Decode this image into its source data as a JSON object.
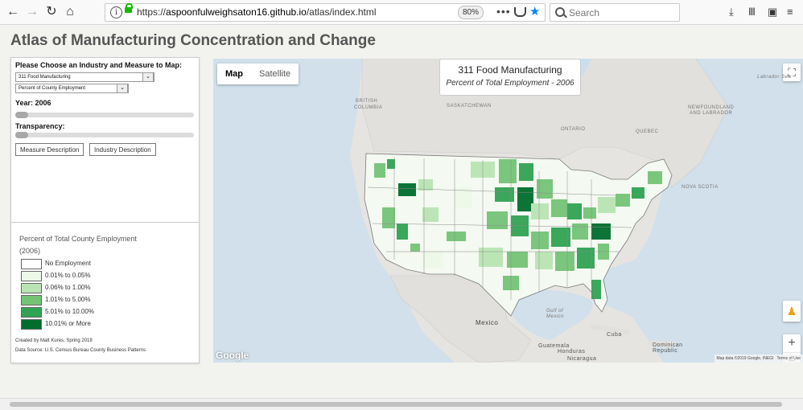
{
  "browser": {
    "url_prefix": "https://",
    "url_host": "aspoonfulweighsaton16.github.io",
    "url_path": "/atlas/index.html",
    "zoom": "80%",
    "search_placeholder": "Search",
    "more_dots": "•••"
  },
  "page": {
    "title": "Atlas of Manufacturing Concentration and Change"
  },
  "controls": {
    "choose_label": "Please Choose an Industry and Measure to Map:",
    "industry_selected": "311 Food Manufacturing",
    "measure_selected": "Percent of County Employment",
    "year_label": "Year: 2006",
    "year_value": 2006,
    "year_slider_fraction": 0,
    "transparency_label": "Transparency:",
    "transparency_slider_fraction": 0,
    "measure_button": "Measure Description",
    "industry_button": "Industry Description"
  },
  "legend": {
    "title": "Percent of Total County Employment",
    "subtitle": "(2006)",
    "items": [
      {
        "label": "No Employment",
        "color": "#ffffff"
      },
      {
        "label": "0.01% to 0.05%",
        "color": "#edf8e9"
      },
      {
        "label": "0.06% to 1.00%",
        "color": "#bae4b3"
      },
      {
        "label": "1.01% to 5.00%",
        "color": "#74c476"
      },
      {
        "label": "5.01% to 10.00%",
        "color": "#31a354"
      },
      {
        "label": "10.01% or More",
        "color": "#006d2c"
      }
    ],
    "credit_author": "Created by Matt Kures, Spring 2019",
    "credit_source": "Data Source: U.S. Census Bureau County Business Patterns"
  },
  "map": {
    "type_map": "Map",
    "type_satellite": "Satellite",
    "info_title": "311 Food Manufacturing",
    "info_subtitle": "Percent of Total Employment - 2006",
    "labels": {
      "bc_1": "BRITISH",
      "bc_2": "COLUMBIA",
      "saskatchewan": "SASKATCHEWAN",
      "ontario": "ONTARIO",
      "quebec": "QUEBEC",
      "newfoundland_1": "NEWFOUNDLAND",
      "newfoundland_2": "AND LABRADOR",
      "nova_scotia": "NOVA SCOTIA",
      "labrador_sea": "Labrador Sea",
      "gulf_1": "Gulf of",
      "gulf_2": "Mexico",
      "mexico": "Mexico",
      "cuba": "Cuba",
      "dominican_1": "Dominican",
      "dominican_2": "Republic",
      "guatemala": "Guatemala",
      "honduras": "Honduras",
      "nicaragua": "Nicaragua"
    },
    "google": "Google",
    "attribution": "Map data ©2019 Google, INEGI",
    "terms": "Terms of Use",
    "zoom_in": "+",
    "zoom_out": "−"
  }
}
